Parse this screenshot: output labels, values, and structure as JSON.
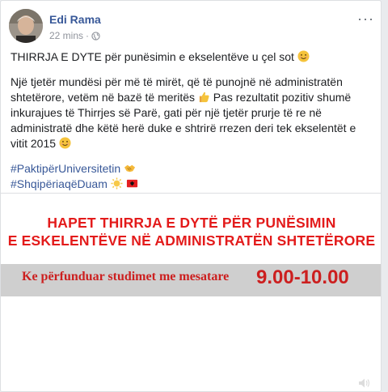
{
  "post": {
    "author": "Edi Rama",
    "time": "22 mins",
    "meta_separator": "·",
    "more_label": "···",
    "paragraph1": "THIRRJA E DYTE për punësimin e ekselentëve u çel sot",
    "paragraph2_a": "Një tjetër mundësi për më të mirët, që të punojnë në administratën shtetërore, vetëm në bazë të meritës",
    "paragraph2_b": " Pas rezultatit pozitiv shumë inkurajues të Thirrjes së Parë, gati për një tjetër prurje të re në administratë dhe këtë herë duke e shtrirë rrezen deri tek ekselentët e vitit 2015",
    "hashtags": [
      "#PaktipërUniversitetin",
      "#ShqipëriaqëDuam"
    ]
  },
  "banner": {
    "headline_line1": "HAPET THIRRJA E DYTË PËR PUNËSIMIN",
    "headline_line2": "E ESKELENTËVE NË ADMINISTRATËN SHTETËRORE",
    "strip_text": "Ke përfunduar studimet me mesatare",
    "strip_value": "9.00-10.00"
  },
  "colors": {
    "link": "#385898",
    "headline_red": "#e31b1b",
    "strip_gray": "#cfcfcf"
  },
  "icons": [
    "globe-icon",
    "more-options-icon",
    "smile-emoji-icon",
    "thumbs-up-emoji-icon",
    "handshake-emoji-icon",
    "sun-emoji-icon",
    "albania-flag-icon",
    "volume-icon"
  ]
}
